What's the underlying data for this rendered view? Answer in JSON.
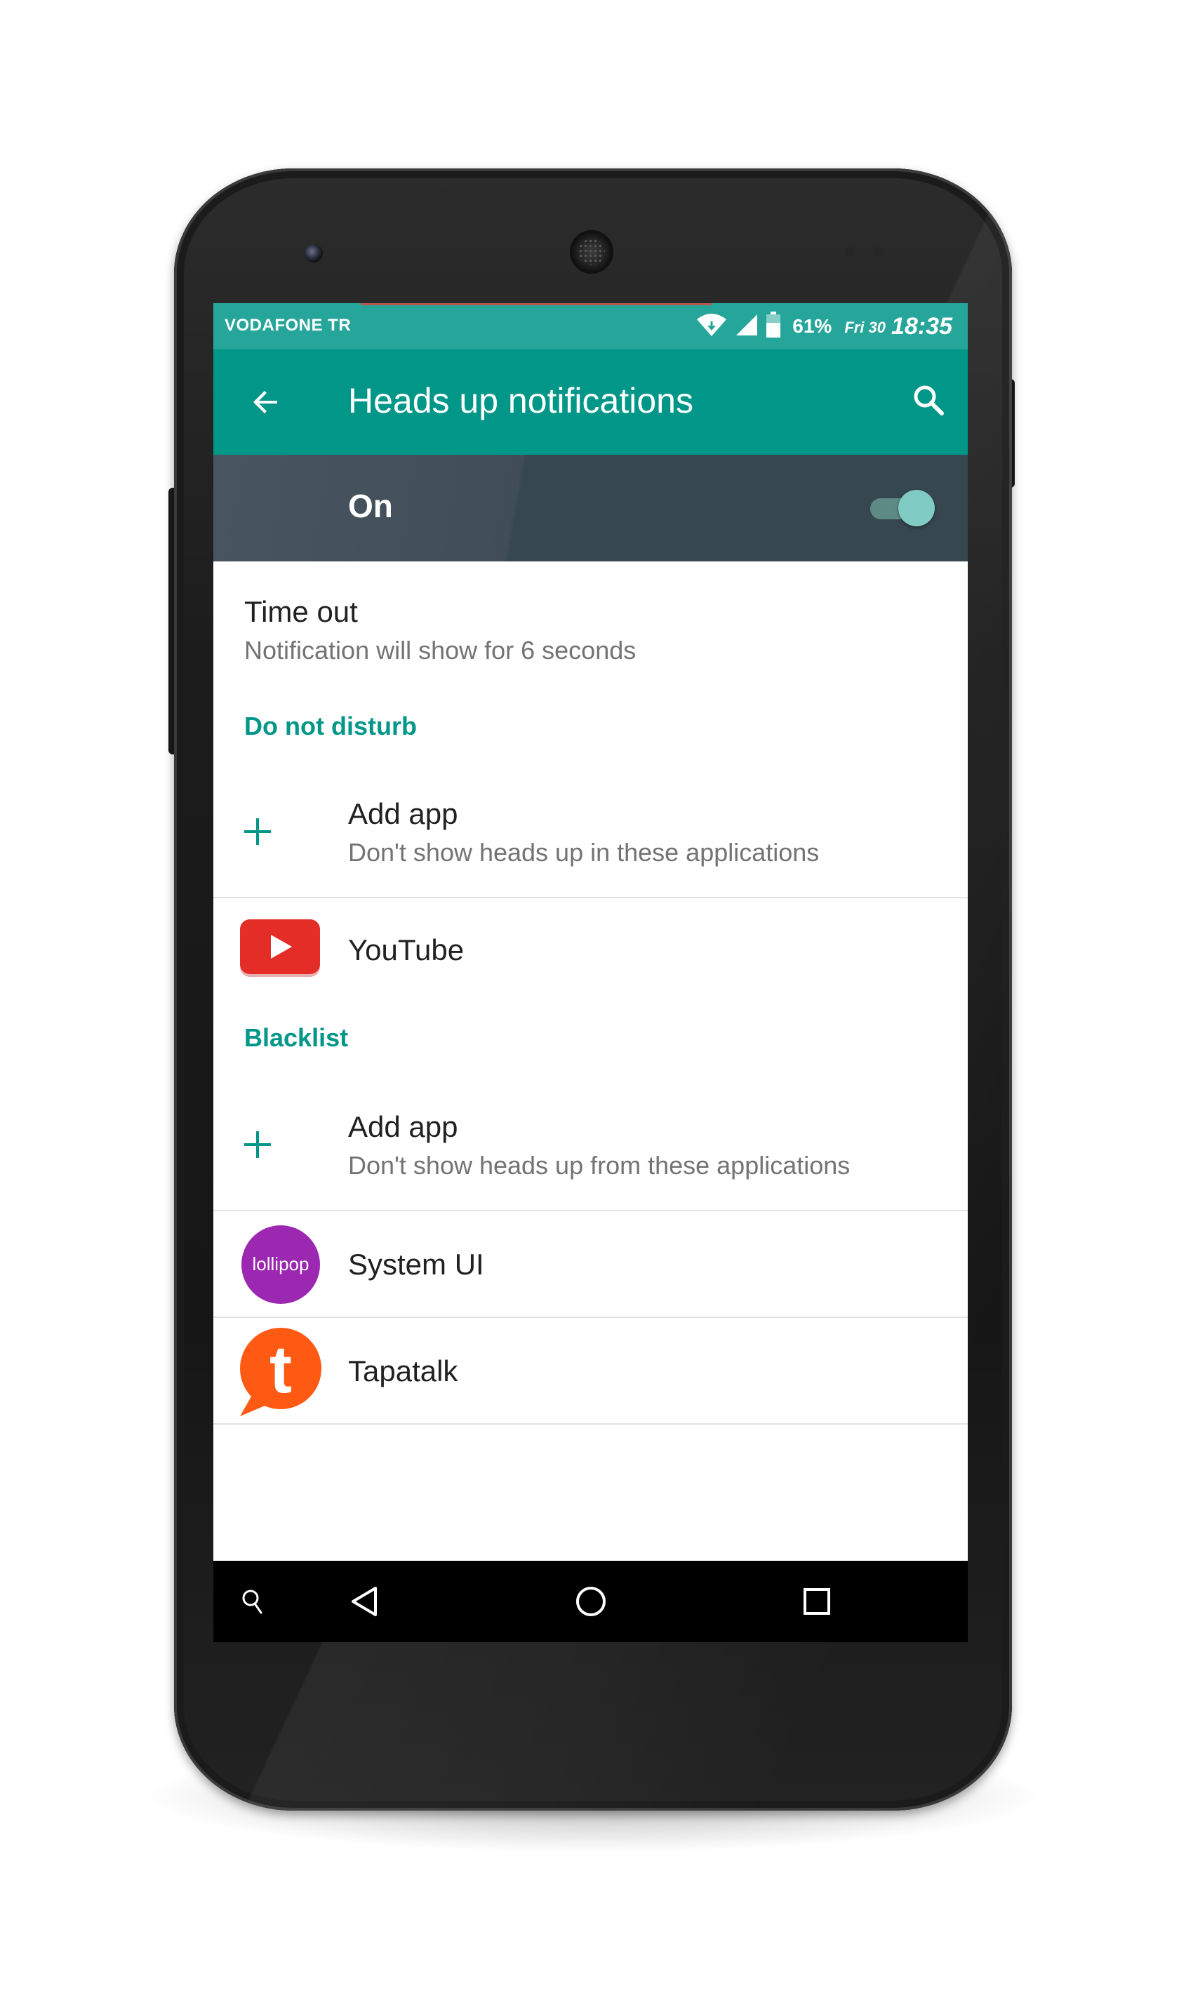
{
  "status_bar": {
    "carrier": "VODAFONE TR",
    "battery_percent": "61%",
    "date": "Fri 30",
    "time": "18:35",
    "icons": [
      "wifi-icon",
      "signal-icon",
      "battery-icon"
    ]
  },
  "app_bar": {
    "title": "Heads up notifications",
    "back_icon": "arrow-back-icon",
    "search_icon": "search-icon",
    "color": "#009688"
  },
  "master_switch": {
    "label": "On",
    "checked": true
  },
  "preferences": {
    "timeout": {
      "title": "Time out",
      "summary": "Notification will show for 6 seconds"
    }
  },
  "do_not_disturb": {
    "header": "Do not disturb",
    "add_app_title": "Add app",
    "add_app_summary": "Don't show heads up in these applications",
    "apps": [
      {
        "name": "YouTube",
        "icon": "youtube-icon"
      }
    ]
  },
  "blacklist": {
    "header": "Blacklist",
    "add_app_title": "Add app",
    "add_app_summary": "Don't show heads up from these applications",
    "apps": [
      {
        "name": "System UI",
        "icon": "lollipop-icon",
        "icon_text": "lollipop"
      },
      {
        "name": "Tapatalk",
        "icon": "tapatalk-icon",
        "icon_text": "t"
      }
    ]
  },
  "nav_bar": {
    "buttons": [
      "search-icon",
      "back-icon",
      "home-icon",
      "recents-icon"
    ]
  },
  "colors": {
    "accent": "#009688",
    "status_bar": "#26a69a",
    "switch_bar": "#37474f",
    "youtube_red": "#e52d27",
    "lollipop_purple": "#9c27b0",
    "tapatalk_orange": "#ff5a13"
  }
}
